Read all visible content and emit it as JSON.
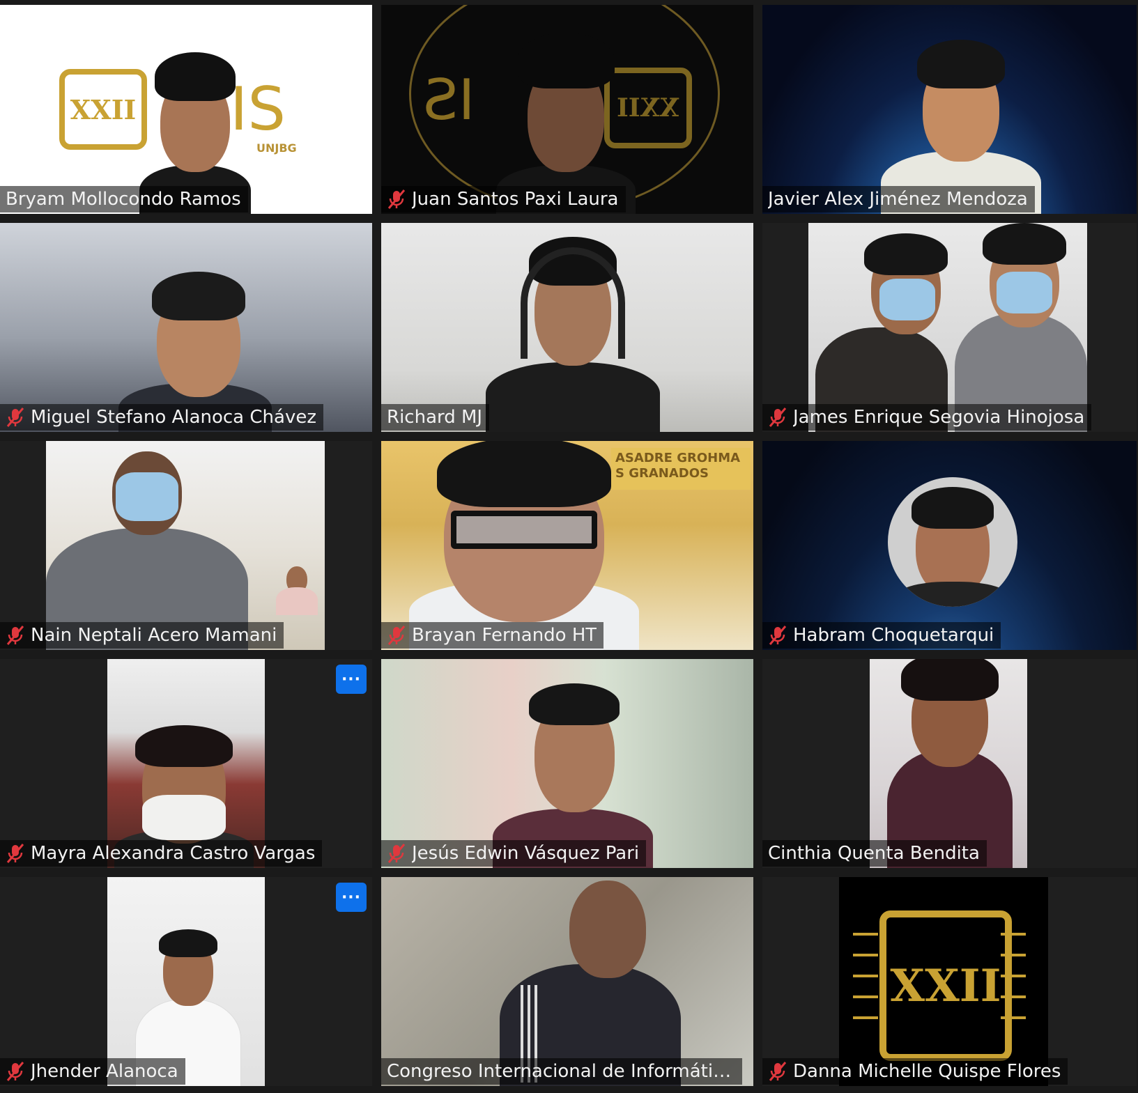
{
  "participants": [
    {
      "name": "Bryam Mollocondo Ramos",
      "muted": false
    },
    {
      "name": "Juan Santos Paxi Laura",
      "muted": true
    },
    {
      "name": "Javier Alex Jiménez Mendoza",
      "muted": false,
      "active_speaker": true
    },
    {
      "name": "Miguel Stefano Alanoca Chávez",
      "muted": true
    },
    {
      "name": "Richard MJ",
      "muted": false
    },
    {
      "name": "James Enrique Segovia Hinojosa",
      "muted": true
    },
    {
      "name": "Nain Neptali Acero Mamani",
      "muted": true
    },
    {
      "name": "Brayan Fernando HT",
      "muted": true
    },
    {
      "name": "Habram Choquetarqui",
      "muted": true
    },
    {
      "name": "Mayra Alexandra Castro Vargas",
      "muted": true,
      "more_label": "···"
    },
    {
      "name": "Jesús Edwin Vásquez Pari",
      "muted": true
    },
    {
      "name": "Cinthia Quenta Bendita",
      "muted": false
    },
    {
      "name": "Jhender Alanoca",
      "muted": true,
      "more_label": "···"
    },
    {
      "name": "Congreso Internacional de Informática y ...",
      "muted": false
    },
    {
      "name": "Danna Michelle Quispe Flores",
      "muted": true
    }
  ],
  "logo": {
    "chip_text": "XXII",
    "is_text": "IS",
    "org_text": "UNJBG"
  },
  "building_sign": {
    "line1": "ASADRE GROHMA",
    "line2": "S GRANADOS"
  },
  "colors": {
    "active_border": "#d8e86b",
    "more_button": "#0e71eb",
    "mute_icon": "#e0383e",
    "logo_gold": "#c9a233"
  }
}
